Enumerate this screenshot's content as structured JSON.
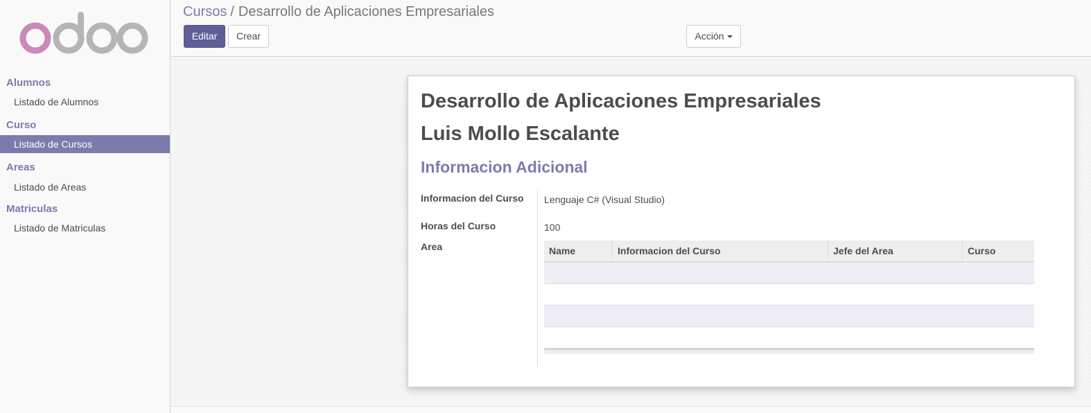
{
  "app": {
    "logo_text": "odoo"
  },
  "sidebar": {
    "sections": [
      {
        "title": "Alumnos",
        "items": [
          {
            "label": "Listado de Alumnos",
            "active": false
          }
        ]
      },
      {
        "title": "Curso",
        "items": [
          {
            "label": "Listado de Cursos",
            "active": true
          }
        ]
      },
      {
        "title": "Areas",
        "items": [
          {
            "label": "Listado de Areas",
            "active": false
          }
        ]
      },
      {
        "title": "Matriculas",
        "items": [
          {
            "label": "Listado de Matriculas",
            "active": false
          }
        ]
      }
    ]
  },
  "breadcrumb": {
    "parent": "Cursos",
    "separator": "/",
    "current": "Desarrollo de Aplicaciones Empresariales"
  },
  "toolbar": {
    "edit_label": "Editar",
    "create_label": "Crear",
    "action_label": "Acción"
  },
  "form": {
    "title": "Desarrollo de Aplicaciones Empresariales",
    "subtitle": "Luis Mollo Escalante",
    "separator": "Informacion Adicional",
    "fields": {
      "info_label": "Informacion del Curso",
      "info_value": "Lenguaje C# (Visual Studio)",
      "hours_label": "Horas del Curso",
      "hours_value": "100",
      "area_label": "Area"
    },
    "area_table": {
      "columns": [
        "Name",
        "Informacion del Curso",
        "Jefe del Area",
        "Curso"
      ],
      "rows": []
    }
  },
  "colors": {
    "brand": "#7c7bad",
    "primary_button": "#5f5e97",
    "logo_o_pink": "#c885b4",
    "logo_grey": "#b3b3b3"
  }
}
